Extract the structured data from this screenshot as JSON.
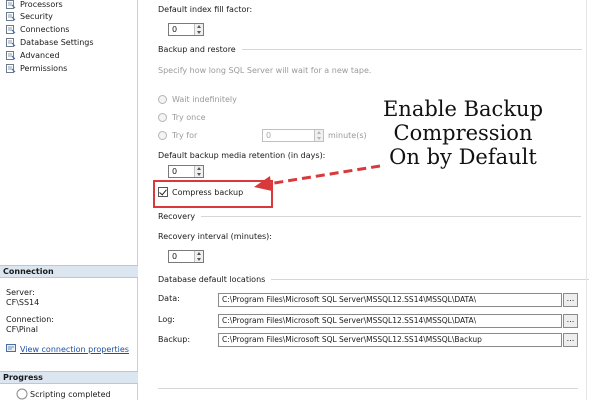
{
  "sidebar": {
    "items": [
      {
        "label": "Processors"
      },
      {
        "label": "Security"
      },
      {
        "label": "Connections"
      },
      {
        "label": "Database Settings"
      },
      {
        "label": "Advanced"
      },
      {
        "label": "Permissions"
      }
    ]
  },
  "connection": {
    "header": "Connection",
    "server_label": "Server:",
    "server_value": "CF\\SS14",
    "connection_label": "Connection:",
    "connection_value": "CF\\Pinal",
    "view_link": "View connection properties"
  },
  "progress": {
    "header": "Progress",
    "status": "Scripting completed"
  },
  "settings": {
    "fill_factor_label": "Default index fill factor:",
    "fill_factor_value": "0",
    "backup_section": "Backup and restore",
    "backup_hint": "Specify how long SQL Server will wait for a new tape.",
    "wait_indefinitely": "Wait indefinitely",
    "try_once": "Try once",
    "try_for": "Try for",
    "try_for_value": "0",
    "minutes_unit": "minute(s)",
    "retention_label": "Default backup media retention (in days):",
    "retention_value": "0",
    "compress_backup": "Compress backup",
    "compress_checked": true,
    "recovery_section": "Recovery",
    "recovery_interval_label": "Recovery interval (minutes):",
    "recovery_interval_value": "0",
    "locations_section": "Database default locations",
    "data_label": "Data:",
    "data_path": "C:\\Program Files\\Microsoft SQL Server\\MSSQL12.SS14\\MSSQL\\DATA\\",
    "log_label": "Log:",
    "log_path": "C:\\Program Files\\Microsoft SQL Server\\MSSQL12.SS14\\MSSQL\\DATA\\",
    "backup_label": "Backup:",
    "backup_path": "C:\\Program Files\\Microsoft SQL Server\\MSSQL12.SS14\\MSSQL\\Backup",
    "browse_label": "..."
  },
  "annotation": {
    "line1": "Enable Backup",
    "line2": "Compression",
    "line3": "On by Default"
  },
  "colors": {
    "highlight": "#d9393a",
    "panel_header": "#dce6f1",
    "link": "#1d4fa8"
  }
}
